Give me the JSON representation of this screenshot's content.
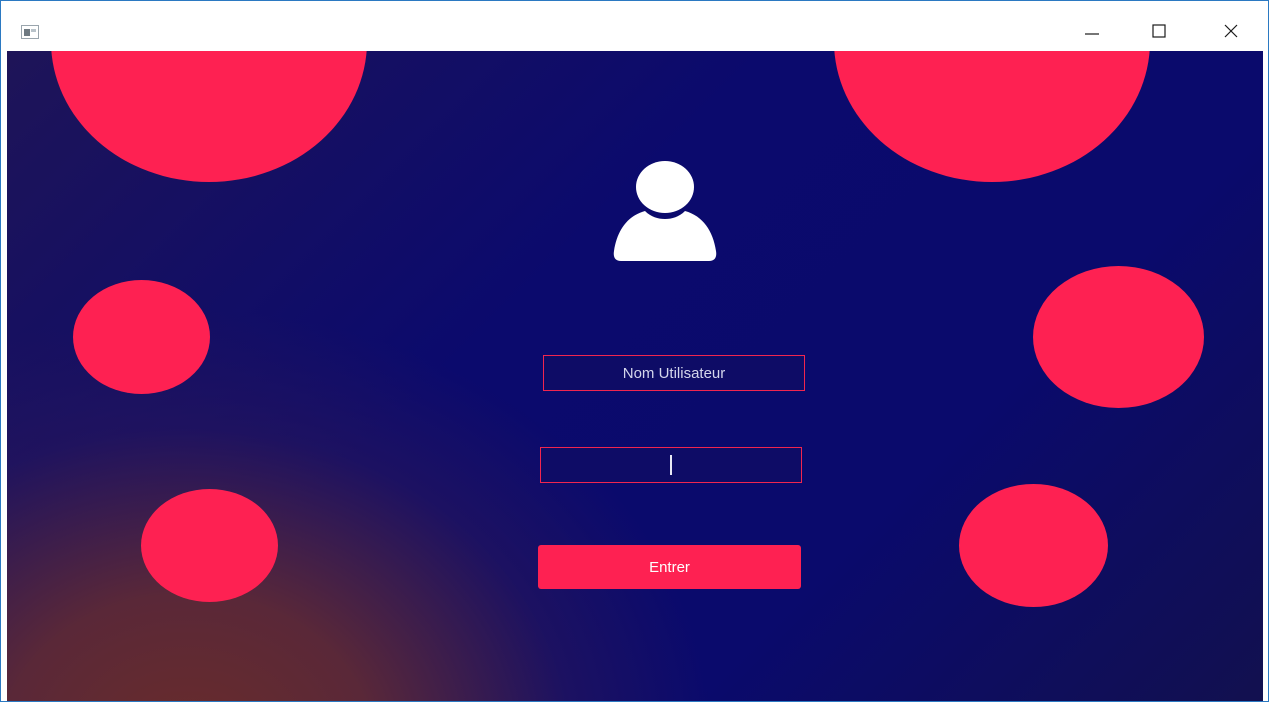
{
  "window": {
    "icon": "app-window-icon",
    "controls": {
      "minimize_icon": "minimize-icon",
      "maximize_icon": "maximize-icon",
      "close_icon": "close-icon"
    }
  },
  "login": {
    "avatar_icon": "user-icon",
    "username": {
      "value": "Nom Utilisateur"
    },
    "password": {
      "value": ""
    },
    "submit_label": "Entrer"
  },
  "colors": {
    "accent": "#fe2152",
    "background_primary": "#0a0a6c",
    "background_secondary": "#6a2c2a",
    "field_border": "#f1254f",
    "text_light": "#ffffff"
  }
}
